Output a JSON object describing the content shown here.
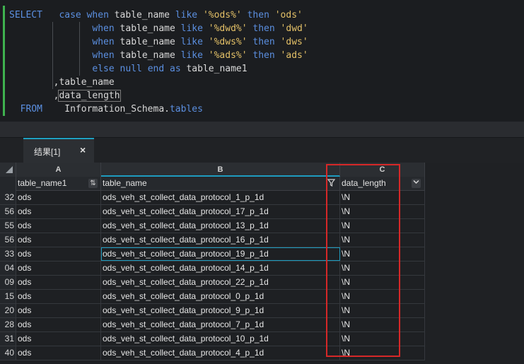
{
  "editor": {
    "lines": [
      [
        {
          "t": "SELECT",
          "c": "kw"
        },
        {
          "t": "   ",
          "c": ""
        },
        {
          "t": "case",
          "c": "kw"
        },
        {
          "t": " ",
          "c": ""
        },
        {
          "t": "when",
          "c": "kw"
        },
        {
          "t": " table_name ",
          "c": "fn"
        },
        {
          "t": "like",
          "c": "kw"
        },
        {
          "t": " ",
          "c": ""
        },
        {
          "t": "'%ods%'",
          "c": "str"
        },
        {
          "t": " ",
          "c": ""
        },
        {
          "t": "then",
          "c": "kw"
        },
        {
          "t": " ",
          "c": ""
        },
        {
          "t": "'ods'",
          "c": "str"
        }
      ],
      [
        {
          "t": "               ",
          "c": ""
        },
        {
          "t": "when",
          "c": "kw"
        },
        {
          "t": " table_name ",
          "c": "fn"
        },
        {
          "t": "like",
          "c": "kw"
        },
        {
          "t": " ",
          "c": ""
        },
        {
          "t": "'%dwd%'",
          "c": "str"
        },
        {
          "t": " ",
          "c": ""
        },
        {
          "t": "then",
          "c": "kw"
        },
        {
          "t": " ",
          "c": ""
        },
        {
          "t": "'dwd'",
          "c": "str"
        }
      ],
      [
        {
          "t": "               ",
          "c": ""
        },
        {
          "t": "when",
          "c": "kw"
        },
        {
          "t": " table_name ",
          "c": "fn"
        },
        {
          "t": "like",
          "c": "kw"
        },
        {
          "t": " ",
          "c": ""
        },
        {
          "t": "'%dws%'",
          "c": "str"
        },
        {
          "t": " ",
          "c": ""
        },
        {
          "t": "then",
          "c": "kw"
        },
        {
          "t": " ",
          "c": ""
        },
        {
          "t": "'dws'",
          "c": "str"
        }
      ],
      [
        {
          "t": "               ",
          "c": ""
        },
        {
          "t": "when",
          "c": "kw"
        },
        {
          "t": " table_name ",
          "c": "fn"
        },
        {
          "t": "like",
          "c": "kw"
        },
        {
          "t": " ",
          "c": ""
        },
        {
          "t": "'%ads%'",
          "c": "str"
        },
        {
          "t": " ",
          "c": ""
        },
        {
          "t": "then",
          "c": "kw"
        },
        {
          "t": " ",
          "c": ""
        },
        {
          "t": "'ads'",
          "c": "str"
        }
      ],
      [
        {
          "t": "               ",
          "c": ""
        },
        {
          "t": "else",
          "c": "kw"
        },
        {
          "t": " ",
          "c": ""
        },
        {
          "t": "null",
          "c": "kw"
        },
        {
          "t": " ",
          "c": ""
        },
        {
          "t": "end",
          "c": "kw"
        },
        {
          "t": " ",
          "c": ""
        },
        {
          "t": "as",
          "c": "kw"
        },
        {
          "t": " table_name1",
          "c": "fn"
        }
      ],
      [
        {
          "t": "        ,table_name",
          "c": "fn"
        }
      ],
      [
        {
          "t": "        ,",
          "c": "fn"
        },
        {
          "t": "data_length",
          "c": "fn cursor-box"
        }
      ],
      [
        {
          "t": "  ",
          "c": ""
        },
        {
          "t": "FROM",
          "c": "kw"
        },
        {
          "t": "    Information_Schema.",
          "c": "fn"
        },
        {
          "t": "tables",
          "c": "kw"
        }
      ]
    ]
  },
  "results_tab": {
    "label": "结果[1]",
    "close": "×"
  },
  "grid": {
    "column_letters": [
      "A",
      "B",
      "C"
    ],
    "headers": [
      "table_name1",
      "table_name",
      "data_length"
    ],
    "rows": [
      {
        "n": "32",
        "a": "ods",
        "b": "ods_veh_st_collect_data_protocol_1_p_1d",
        "c": "\\N"
      },
      {
        "n": "56",
        "a": "ods",
        "b": "ods_veh_st_collect_data_protocol_17_p_1d",
        "c": "\\N"
      },
      {
        "n": "55",
        "a": "ods",
        "b": "ods_veh_st_collect_data_protocol_13_p_1d",
        "c": "\\N"
      },
      {
        "n": "56",
        "a": "ods",
        "b": "ods_veh_st_collect_data_protocol_16_p_1d",
        "c": "\\N"
      },
      {
        "n": "33",
        "a": "ods",
        "b": "ods_veh_st_collect_data_protocol_19_p_1d",
        "c": "\\N"
      },
      {
        "n": "04",
        "a": "ods",
        "b": "ods_veh_st_collect_data_protocol_14_p_1d",
        "c": "\\N"
      },
      {
        "n": "09",
        "a": "ods",
        "b": "ods_veh_st_collect_data_protocol_22_p_1d",
        "c": "\\N"
      },
      {
        "n": "15",
        "a": "ods",
        "b": "ods_veh_st_collect_data_protocol_0_p_1d",
        "c": "\\N"
      },
      {
        "n": "20",
        "a": "ods",
        "b": "ods_veh_st_collect_data_protocol_9_p_1d",
        "c": "\\N"
      },
      {
        "n": "28",
        "a": "ods",
        "b": "ods_veh_st_collect_data_protocol_7_p_1d",
        "c": "\\N"
      },
      {
        "n": "31",
        "a": "ods",
        "b": "ods_veh_st_collect_data_protocol_10_p_1d",
        "c": "\\N"
      },
      {
        "n": "40",
        "a": "ods",
        "b": "ods_veh_st_collect_data_protocol_4_p_1d",
        "c": "\\N"
      }
    ],
    "selected_row_index": 4
  },
  "icons": {
    "sort": "sort-az-icon",
    "filter": "filter-icon",
    "dropdown": "chevron-down-icon"
  },
  "colors": {
    "keyword": "#5b8fe0",
    "string": "#e3c067",
    "accent": "#1e9bbf",
    "highlight_box": "#d62828",
    "gutter_marker": "#3fb24f"
  }
}
